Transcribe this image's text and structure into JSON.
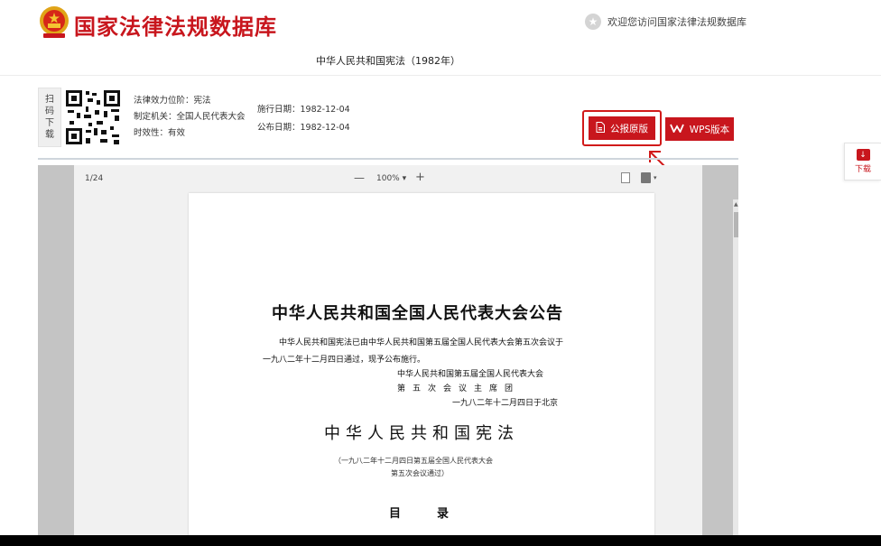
{
  "header": {
    "site_title": "国家法律法规数据库",
    "welcome_text": "欢迎您访问国家法律法规数据库"
  },
  "law": {
    "title": "中华人民共和国宪法（1982年）"
  },
  "info": {
    "qr_label": [
      "扫",
      "码",
      "下",
      "载"
    ],
    "effect_level": "法律效力位阶：宪法",
    "issuing_body": "制定机关：全国人民代表大会",
    "validity": "时效性：有效",
    "effective_date": "施行日期：1982-12-04",
    "publish_date": "公布日期：1982-12-04"
  },
  "buttons": {
    "gazette": "公报原版",
    "wps": "WPS版本"
  },
  "side": {
    "download": "下载"
  },
  "viewer": {
    "page_count": "1/24",
    "zoom_out": "—",
    "zoom": "100% ▾",
    "zoom_in": "+"
  },
  "document": {
    "announce_title": "中华人民共和国全国人民代表大会公告",
    "announce_body1": "中华人民共和国宪法已由中华人民共和国第五届全国人民代表大会第五次会议于",
    "announce_body2": "一九八二年十二月四日通过，现予公布施行。",
    "signature1": "中华人民共和国第五届全国人民代表大会",
    "signature2": "第五次会议主席团",
    "signature_date": "一九八二年十二月四日于北京",
    "const_title": "中华人民共和国宪法",
    "const_note1": "（一九八二年十二月四日第五届全国人民代表大会",
    "const_note2": "第五次会议通过）",
    "toc": "目录"
  },
  "colors": {
    "brand_red": "#c8161d",
    "highlight_red": "#d11a1a"
  },
  "icons": {
    "emblem": "national-emblem",
    "welcome": "star-icon",
    "gazette": "pdf-icon",
    "wps": "wps-icon",
    "download": "download-icon"
  }
}
